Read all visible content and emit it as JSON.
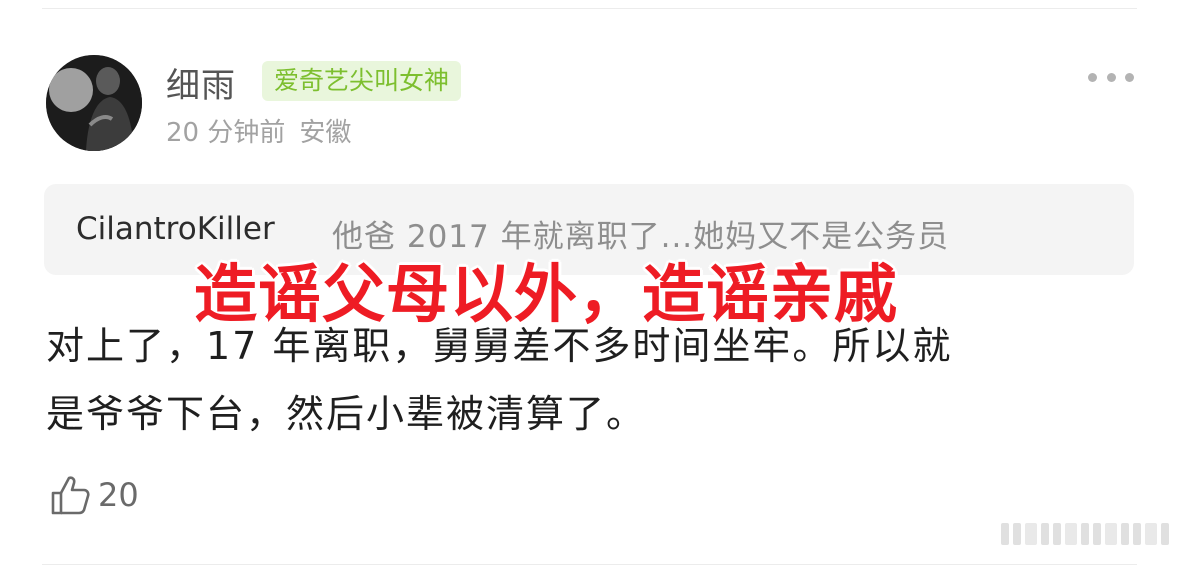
{
  "post": {
    "username": "细雨",
    "badge": "爱奇艺尖叫女神",
    "time": "20 分钟前",
    "location": "安徽",
    "more_icon": "more-horizontal-icon"
  },
  "quote": {
    "user": "CilantroKiller",
    "text": "他爸 2017 年就离职了...她妈又不是公务员"
  },
  "comment": {
    "line1": "对上了，17 年离职，舅舅差不多时间坐牢。所以就",
    "line2": "是爷爷下台，然后小辈被清算了。"
  },
  "overlay": {
    "text": "造谣父母以外，造谣亲戚",
    "color": "#ee1c24"
  },
  "actions": {
    "like_icon": "thumbs-up-icon",
    "like_count": "20"
  },
  "colors": {
    "badge_bg": "#e9f6dc",
    "badge_text": "#7dbf2f",
    "quote_bg": "#f4f4f4"
  }
}
